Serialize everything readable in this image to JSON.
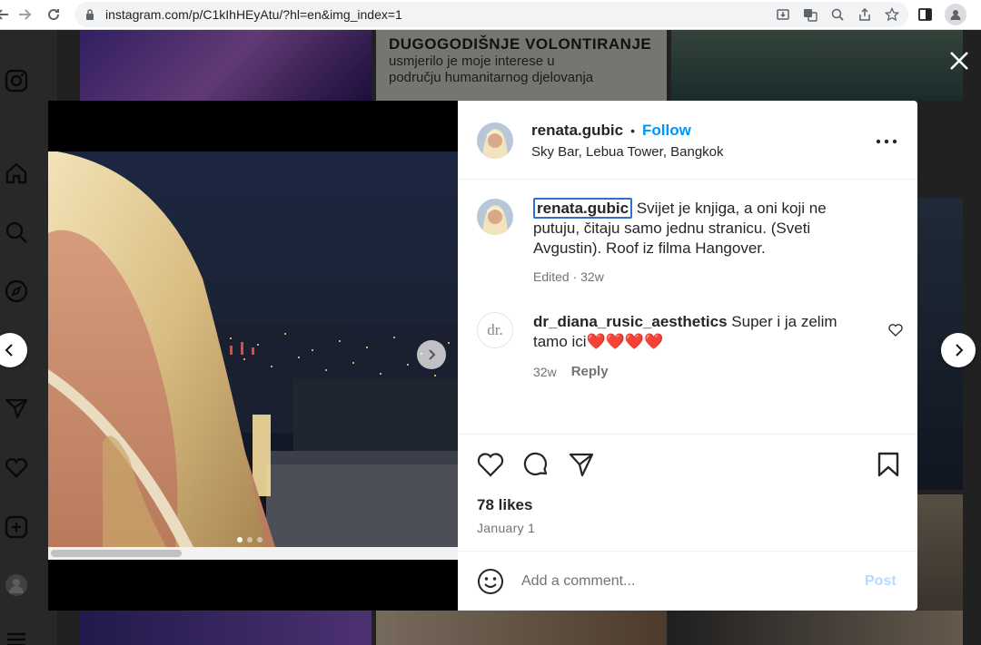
{
  "browser": {
    "url": "instagram.com/p/C1kIhHEyAtu/?hl=en&img_index=1"
  },
  "background": {
    "tile_headline": "DUGOGODIŠNJE VOLONTIRANJE",
    "tile_line1": "usmjerilo je moje interese u",
    "tile_line2": "području humanitarnog djelovanja"
  },
  "post": {
    "username": "renata.gubic",
    "separator": "•",
    "follow_label": "Follow",
    "location": "Sky Bar, Lebua Tower, Bangkok",
    "caption": {
      "author": "renata.gubic",
      "text": "Svijet je knjiga, a oni koji ne putuju, čitaju samo jednu stranicu. (Sveti Avgustin). Roof iz filma Hangover.",
      "meta": "Edited · 32w"
    },
    "comments": [
      {
        "author": "dr_diana_rusic_aesthetics",
        "text": "Super i ja zelim tamo ici❤️❤️❤️❤️",
        "age": "32w",
        "reply_label": "Reply",
        "avatar_text": "dr."
      }
    ],
    "likes": "78 likes",
    "date": "January 1",
    "comment_placeholder": "Add a comment...",
    "post_label": "Post"
  },
  "colors": {
    "accent": "#0095f6",
    "post_disabled": "#b3dbff",
    "text": "#262626",
    "muted": "#737373"
  },
  "icons": {
    "close": "close-icon",
    "more": "more-options-icon",
    "like": "heart-icon",
    "comment": "comment-icon",
    "share": "share-icon",
    "save": "bookmark-icon",
    "emoji": "emoji-icon",
    "prev": "chevron-left-icon",
    "next": "chevron-right-icon"
  }
}
